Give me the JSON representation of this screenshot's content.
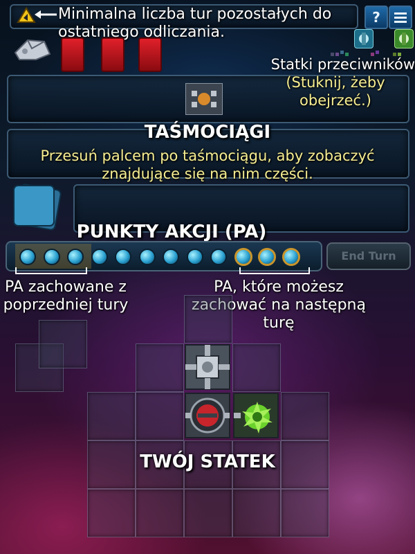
{
  "top_bar": {
    "countdown_hint": "Minimalna liczba tur pozostałych do ostatniego odliczania.",
    "help_icon": "question-icon",
    "menu_icon": "hamburger-menu-icon"
  },
  "opponents": {
    "hint_title": "Statki przeciwników",
    "hint_tap": "(Stuknij, żeby obejrzeć.)"
  },
  "conveyor": {
    "title": "TAŚMOCIĄGI",
    "hint": "Przesuń palcem po taśmociągu, aby zobaczyć znajdujące się na nim części."
  },
  "action_points": {
    "title": "PUNKTY AKCJI (PA)",
    "saved_from_previous": "PA zachowane z poprzedniej tury",
    "saveable_for_next": "PA, które możesz zachować na następną turę",
    "total": 12,
    "saved_count": 3,
    "saveable_count": 3
  },
  "end_turn_label": "End Turn",
  "ship": {
    "title": "TWÓJ STATEK"
  },
  "colors": {
    "hint_text": "#f6ee92",
    "panel_border": "#3c5a74",
    "orb_gold_ring": "#c9952c",
    "card_red": "#e0202a"
  }
}
